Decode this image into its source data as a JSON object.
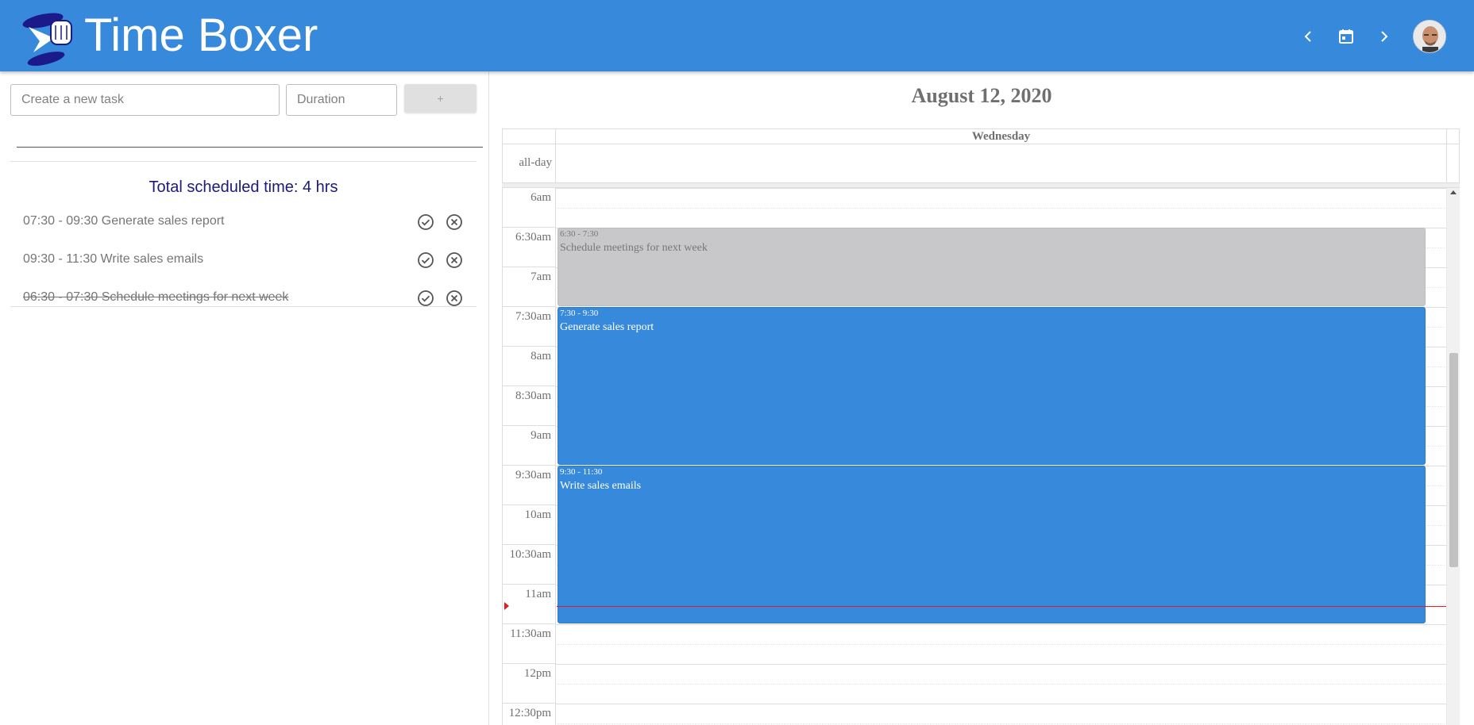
{
  "header": {
    "title": "Time Boxer",
    "bg_color": "#3789db",
    "prev_icon": "chevron-left-icon",
    "calendar_icon": "calendar-today-icon",
    "next_icon": "chevron-right-icon",
    "avatar": "user-avatar"
  },
  "task_form": {
    "task_placeholder": "Create a new task",
    "duration_placeholder": "Duration",
    "add_label": "+"
  },
  "task_list": {
    "total_text": "Total scheduled time: 4 hrs",
    "items": [
      {
        "text": "07:30 - 09:30 Generate sales report",
        "done": false
      },
      {
        "text": "09:30 - 11:30 Write sales emails",
        "done": false
      },
      {
        "text": "06:30 - 07:30 Schedule meetings for next week",
        "done": true
      }
    ]
  },
  "calendar": {
    "date_title": "August 12, 2020",
    "day_header": "Wednesday",
    "allday_label": "all-day",
    "time_labels": [
      "6am",
      "6:30am",
      "7am",
      "7:30am",
      "8am",
      "8:30am",
      "9am",
      "9:30am",
      "10am",
      "10:30am",
      "11am",
      "11:30am",
      "12pm",
      "12:30pm"
    ],
    "events": [
      {
        "time": "6:30 - 7:30",
        "title": "Schedule meetings for next week",
        "color": "grey"
      },
      {
        "time": "7:30 - 9:30",
        "title": "Generate sales report",
        "color": "blue"
      },
      {
        "time": "9:30 - 11:30",
        "title": "Write sales emails",
        "color": "blue"
      }
    ],
    "event_color": "#3789db",
    "done_event_color": "#c8c8ca",
    "now_indicator_color": "#e02020"
  }
}
